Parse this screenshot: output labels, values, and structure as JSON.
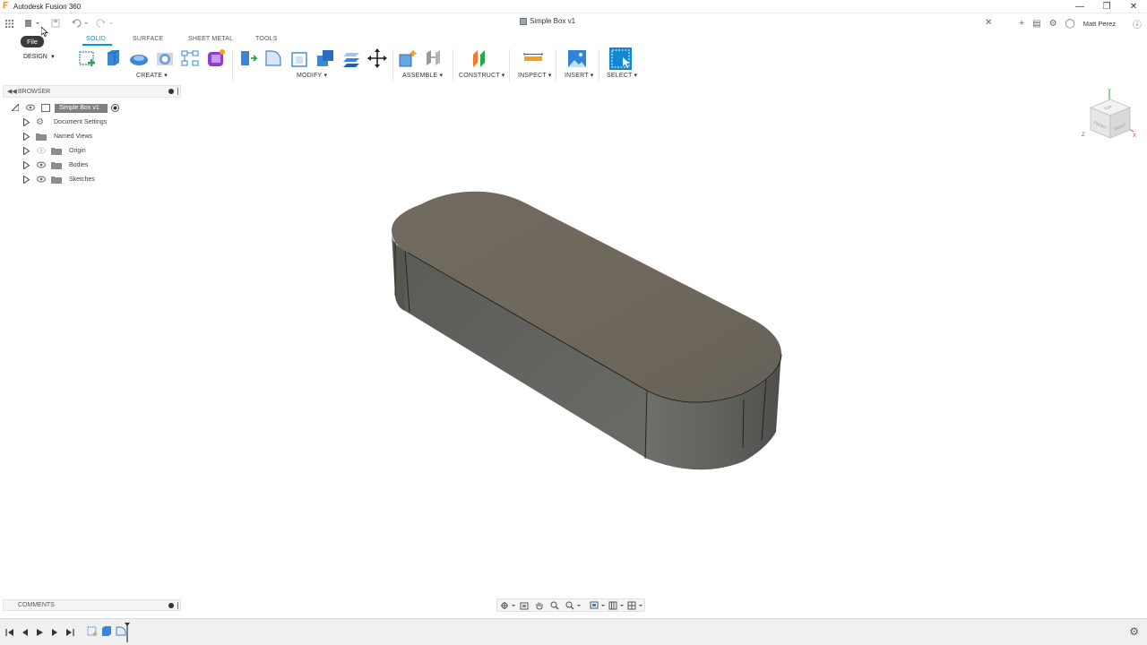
{
  "window": {
    "app_title": "Autodesk Fusion 360",
    "document_tab": "Simple Box v1",
    "user_name": "Matt Perez",
    "tooltip_file": "File"
  },
  "workspace": {
    "label": "DESIGN"
  },
  "ribbon": {
    "tabs": [
      "SOLID",
      "SURFACE",
      "SHEET METAL",
      "TOOLS"
    ],
    "active_tab": "SOLID",
    "groups": [
      "CREATE",
      "MODIFY",
      "ASSEMBLE",
      "CONSTRUCT",
      "INSPECT",
      "INSERT",
      "SELECT"
    ]
  },
  "browser": {
    "title": "BROWSER",
    "root": "Simple Box v1",
    "items": [
      "Document Settings",
      "Named Views",
      "Origin",
      "Bodies",
      "Sketches"
    ]
  },
  "viewcube": {
    "faces": [
      "TOP",
      "FRONT",
      "RIGHT"
    ],
    "axes": [
      "Y",
      "Z",
      "X"
    ]
  },
  "comments": {
    "title": "COMMENTS"
  },
  "colors": {
    "accent": "#0696d7",
    "body_top": "#6b665e",
    "body_side": "#5f605b",
    "select_tool": "#1088d6"
  },
  "icons": [
    "grid-icon",
    "file-icon",
    "save-icon",
    "undo-icon",
    "redo-icon",
    "close-icon",
    "plus-icon",
    "job-status-icon",
    "extensions-icon",
    "notification-icon",
    "help-icon",
    "gear-icon",
    "eye-icon",
    "folder-icon",
    "radio-icon"
  ]
}
